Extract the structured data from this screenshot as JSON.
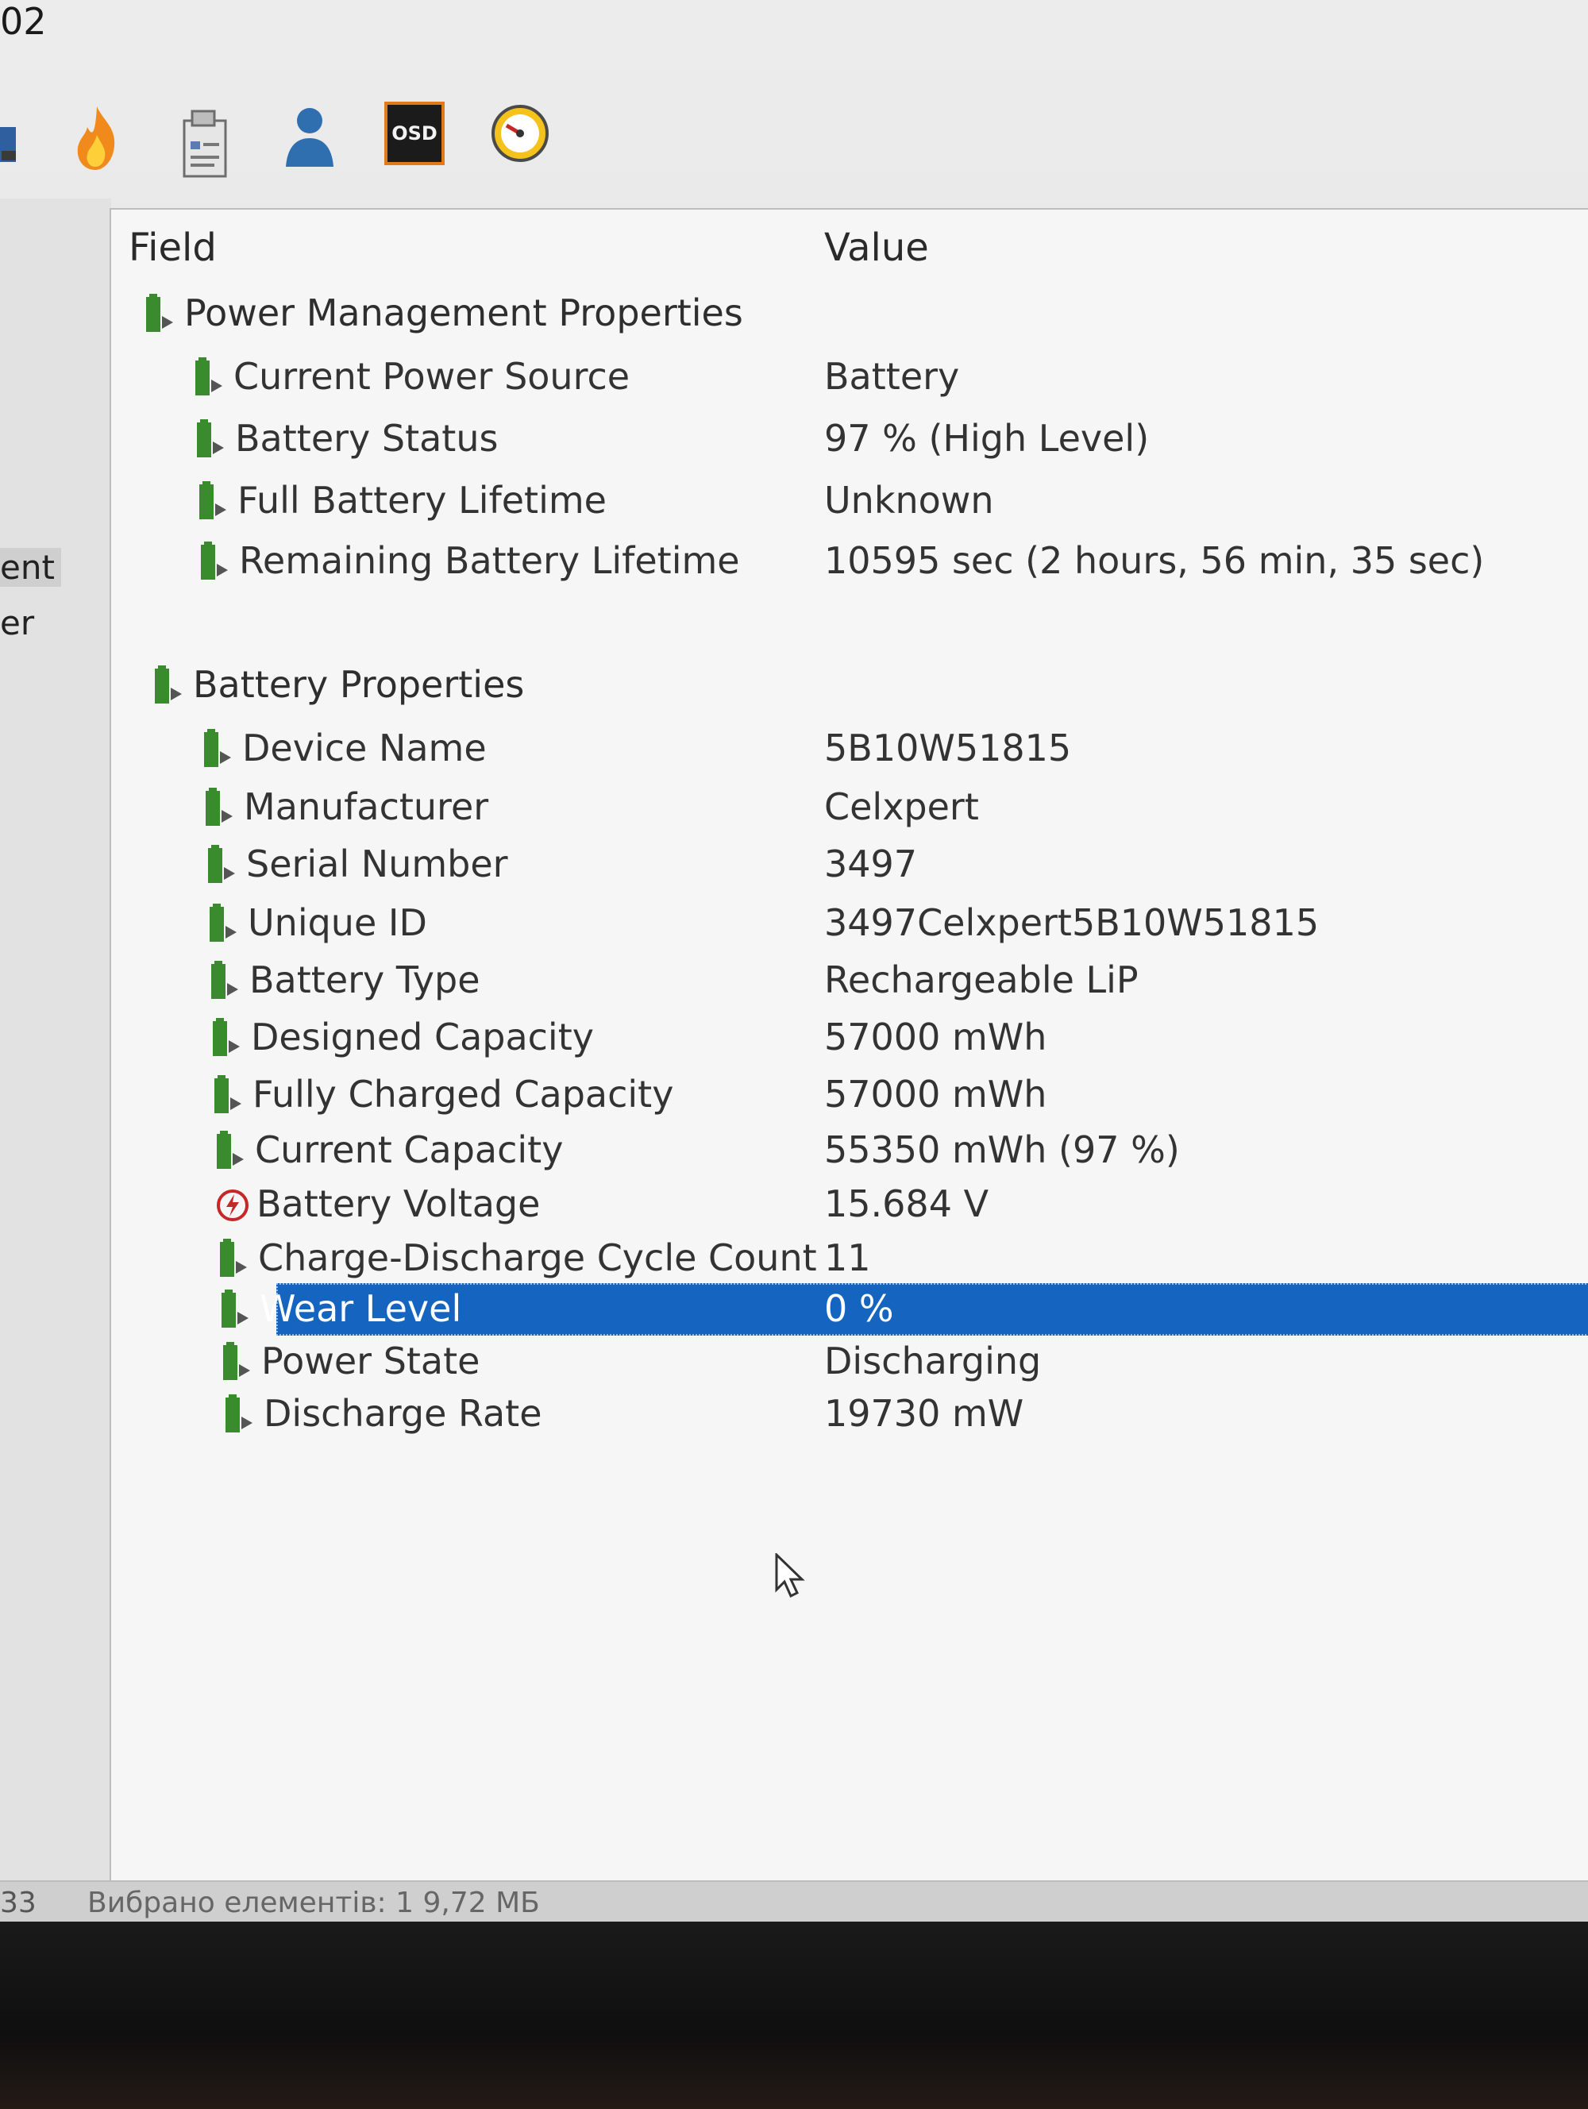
{
  "window": {
    "title_fragment": "02"
  },
  "toolbar": {
    "icons": [
      "app-icon",
      "flame-icon",
      "report-icon",
      "user-icon",
      "osd-icon",
      "gauge-icon"
    ],
    "osd_label": "OSD"
  },
  "left_pane": {
    "items": [
      "ent",
      "er"
    ]
  },
  "table": {
    "headers": {
      "field": "Field",
      "value": "Value"
    },
    "rows": [
      {
        "field": "Power Management Properties",
        "value": "",
        "level": 0,
        "icon": "battery-icon"
      },
      {
        "field": "Current Power Source",
        "value": "Battery",
        "level": 1,
        "icon": "battery-icon"
      },
      {
        "field": "Battery Status",
        "value": "97 % (High Level)",
        "level": 1,
        "icon": "battery-icon"
      },
      {
        "field": "Full Battery Lifetime",
        "value": "Unknown",
        "level": 1,
        "icon": "battery-icon"
      },
      {
        "field": "Remaining Battery Lifetime",
        "value": "10595 sec (2 hours, 56 min, 35 sec)",
        "level": 1,
        "icon": "battery-icon"
      },
      {
        "field": "Battery Properties",
        "value": "",
        "level": 0,
        "icon": "battery-icon"
      },
      {
        "field": "Device Name",
        "value": "5B10W51815",
        "level": 1,
        "icon": "battery-icon"
      },
      {
        "field": "Manufacturer",
        "value": "Celxpert",
        "level": 1,
        "icon": "battery-icon"
      },
      {
        "field": "Serial Number",
        "value": "3497",
        "level": 1,
        "icon": "battery-icon"
      },
      {
        "field": "Unique ID",
        "value": "3497Celxpert5B10W51815",
        "level": 1,
        "icon": "battery-icon"
      },
      {
        "field": "Battery Type",
        "value": "Rechargeable LiP",
        "level": 1,
        "icon": "battery-icon"
      },
      {
        "field": "Designed Capacity",
        "value": "57000 mWh",
        "level": 1,
        "icon": "battery-icon"
      },
      {
        "field": "Fully Charged Capacity",
        "value": "57000 mWh",
        "level": 1,
        "icon": "battery-icon"
      },
      {
        "field": "Current Capacity",
        "value": "55350 mWh  (97 %)",
        "level": 1,
        "icon": "battery-icon"
      },
      {
        "field": "Battery Voltage",
        "value": "15.684 V",
        "level": 1,
        "icon": "voltage-icon"
      },
      {
        "field": "Charge-Discharge Cycle Count",
        "value": "11",
        "level": 1,
        "icon": "battery-icon"
      },
      {
        "field": "Wear Level",
        "value": "0 %",
        "level": 1,
        "icon": "battery-icon",
        "selected": true
      },
      {
        "field": "Power State",
        "value": "Discharging",
        "level": 1,
        "icon": "battery-icon"
      },
      {
        "field": "Discharge Rate",
        "value": "19730 mW",
        "level": 1,
        "icon": "battery-icon"
      }
    ]
  },
  "statusbar": {
    "left": "33",
    "text": "Вибрано елементів: 1  9,72 МБ"
  },
  "colors": {
    "selection": "#1565c0",
    "battery_icon": "#3a8a2e",
    "voltage_icon": "#c62828"
  }
}
